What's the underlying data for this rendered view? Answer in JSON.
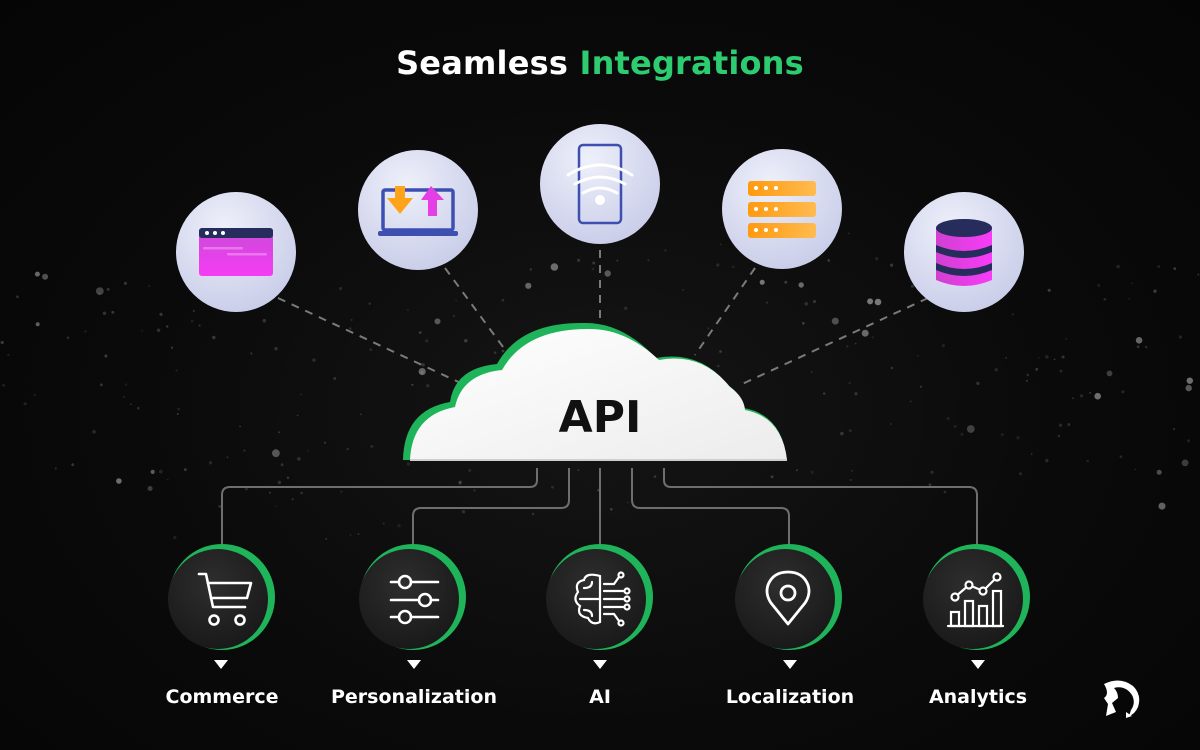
{
  "header": {
    "title_plain": "Seamless",
    "title_accent": "Integrations"
  },
  "colors": {
    "background": "#0a0a0a",
    "accent_green": "#2ecc71",
    "cloud": "#f4f4f4",
    "top_node_bg": "#e4e6f6",
    "bottom_node_bg": "#222222",
    "magenta": "#e83ee8",
    "orange": "#ffa31a",
    "navy": "#262c5c",
    "blue": "#3d4fb0",
    "connector": "#7a7a7a"
  },
  "center": {
    "label": "API",
    "icon": "cloud-icon"
  },
  "top_nodes": [
    {
      "id": "web-app",
      "icon": "browser-window-icon"
    },
    {
      "id": "data-transfer",
      "icon": "laptop-upload-download-icon"
    },
    {
      "id": "mobile",
      "icon": "mobile-wireless-icon"
    },
    {
      "id": "server",
      "icon": "server-rack-icon"
    },
    {
      "id": "database",
      "icon": "database-icon"
    }
  ],
  "bottom_nodes": [
    {
      "label": "Commerce",
      "icon": "shopping-cart-icon"
    },
    {
      "label": "Personalization",
      "icon": "sliders-icon"
    },
    {
      "label": "AI",
      "icon": "ai-brain-circuit-icon"
    },
    {
      "label": "Localization",
      "icon": "location-pin-icon"
    },
    {
      "label": "Analytics",
      "icon": "analytics-chart-icon"
    }
  ],
  "brand": {
    "logo": "spartan-helmet-logo-icon"
  }
}
